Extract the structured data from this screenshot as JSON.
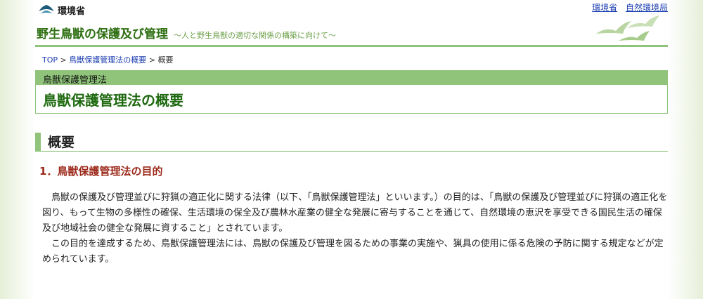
{
  "header": {
    "ministry_name": "環境省",
    "site_title": "野生鳥獣の保護及び管理",
    "site_subtitle": "～人と野生鳥獣の適切な関係の構築に向けて～",
    "links": [
      "環境省",
      "自然環境局"
    ]
  },
  "breadcrumb": {
    "items": [
      "TOP",
      "鳥獣保護管理法の概要",
      "概要"
    ],
    "separator": ">"
  },
  "category": {
    "label": "鳥獣保護管理法",
    "page_title": "鳥獣保護管理法の概要"
  },
  "section": {
    "heading": "概要",
    "subheading": "1．鳥獣保護管理法の目的",
    "paragraphs": [
      "鳥獣の保護及び管理並びに狩猟の適正化に関する法律（以下、「鳥獣保護管理法」といいます。）の目的は、「鳥獣の保護及び管理並びに狩猟の適正化を図り、もって生物の多様性の確保、生活環境の保全及び農林水産業の健全な発展に寄与することを通じて、自然環境の恵沢を享受できる国民生活の確保及び地域社会の健全な発展に資すること」とされています。",
      "この目的を達成するため、鳥獣保護管理法には、鳥獣の保護及び管理を図るための事業の実施や、猟具の使用に係る危険の予防に関する規定などが定められています。"
    ]
  },
  "colors": {
    "accent_green": "#8fc47a",
    "title_green": "#1f6a10",
    "subheading_red": "#9c2a1b",
    "link_blue": "#1a3cb0"
  },
  "icons": [
    "ministry-logo-icon",
    "swallows-decoration-icon"
  ]
}
